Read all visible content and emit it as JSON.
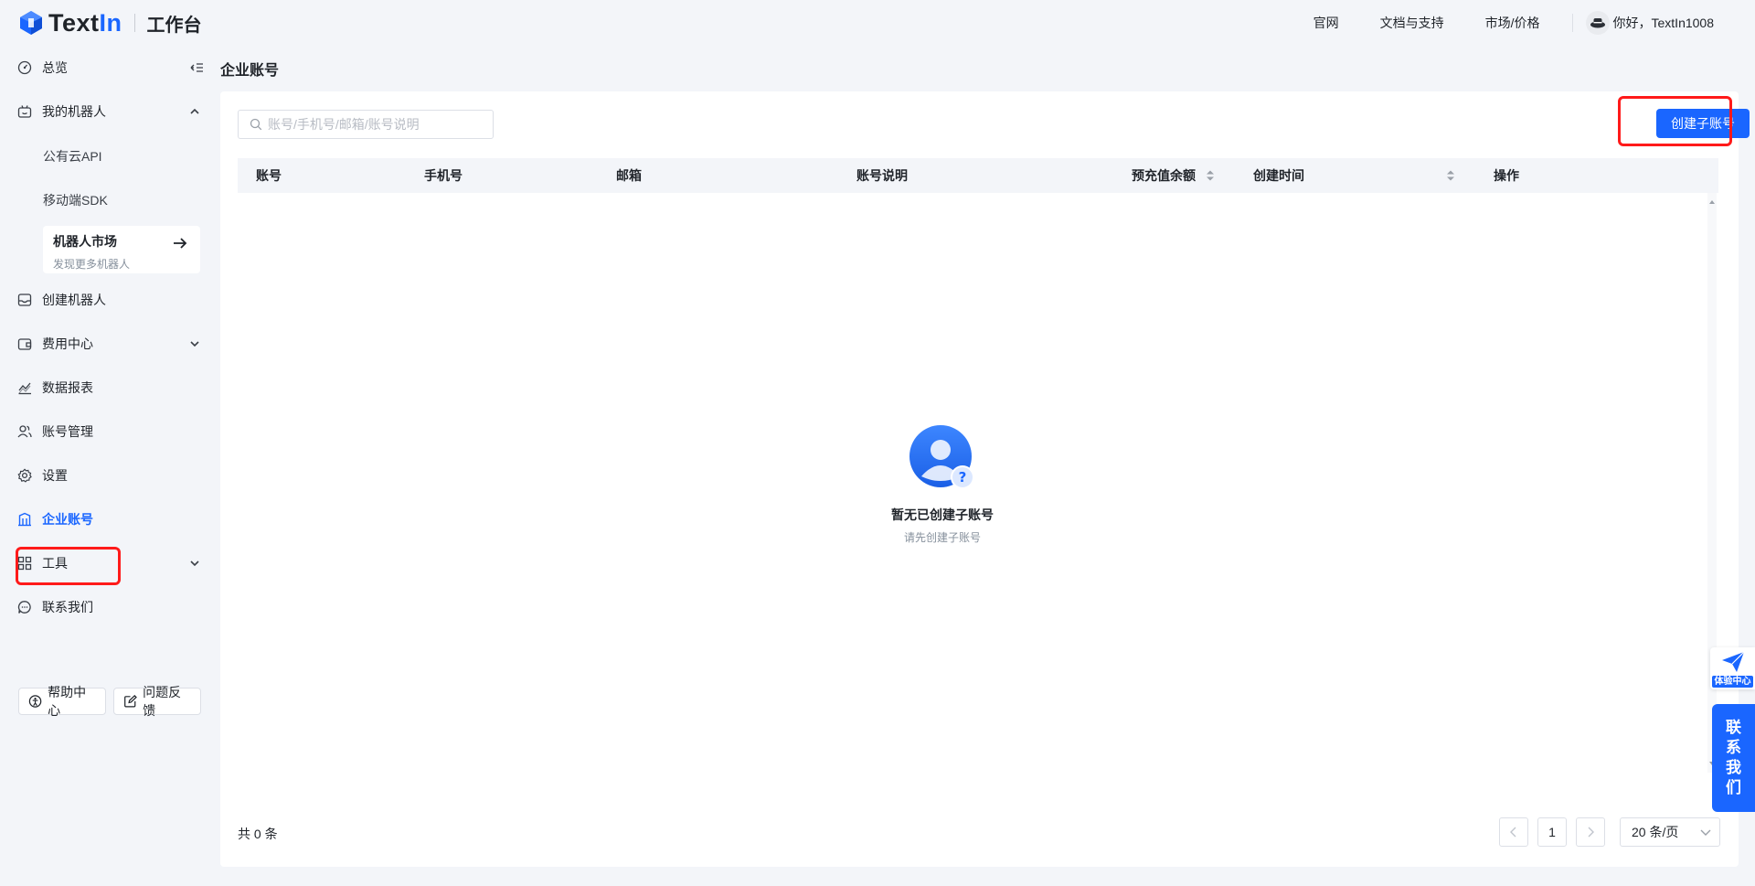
{
  "brand": {
    "logo_text_a": "Text",
    "logo_text_b": "In",
    "subtitle": "工作台",
    "accent": "#1a66ff"
  },
  "topnav": {
    "website": "官网",
    "docs": "文档与支持",
    "market": "市场/价格",
    "greeting": "你好，TextIn1008"
  },
  "sidebar": {
    "overview": "总览",
    "my_robots": "我的机器人",
    "public_api": "公有云API",
    "mobile_sdk": "移动端SDK",
    "robot_market": {
      "title": "机器人市场",
      "subtitle": "发现更多机器人"
    },
    "create_robot": "创建机器人",
    "billing": "费用中心",
    "reports": "数据报表",
    "account_mgmt": "账号管理",
    "settings": "设置",
    "enterprise": "企业账号",
    "tools": "工具",
    "contact": "联系我们",
    "help_center": "帮助中心",
    "feedback": "问题反馈"
  },
  "main": {
    "page_title": "企业账号",
    "search_placeholder": "账号/手机号/邮箱/账号说明",
    "create_button": "创建子账号",
    "columns": [
      "账号",
      "手机号",
      "邮箱",
      "账号说明",
      "预充值余额",
      "创建时间",
      "操作"
    ],
    "empty_title": "暂无已创建子账号",
    "empty_subtitle": "请先创建子账号",
    "total": "共 0 条",
    "current_page": "1",
    "page_size": "20 条/页"
  },
  "floating": {
    "experience": "体验中心",
    "contact": [
      "联",
      "系",
      "我",
      "们"
    ]
  }
}
